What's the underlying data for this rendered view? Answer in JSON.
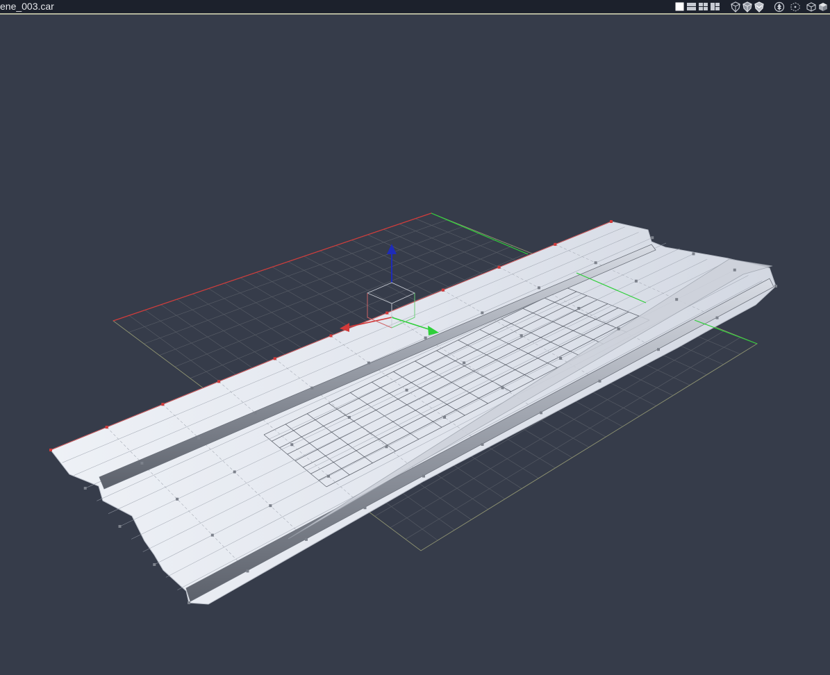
{
  "window": {
    "title": "ene_003.car"
  },
  "toolbar": {
    "layout_buttons": [
      {
        "icon": "single-view-icon",
        "active": true
      },
      {
        "icon": "two-row-view-icon",
        "active": false
      },
      {
        "icon": "four-view-icon",
        "active": false
      },
      {
        "icon": "three-view-icon",
        "active": false
      }
    ],
    "shading_buttons": [
      {
        "icon": "wireframe-shield-icon"
      },
      {
        "icon": "flat-shield-icon"
      },
      {
        "icon": "smooth-shield-icon"
      }
    ],
    "view_buttons": [
      {
        "icon": "tree-icon"
      },
      {
        "icon": "selection-cube-icon"
      },
      {
        "icon": "wire-cube-icon"
      },
      {
        "icon": "solid-cube-icon"
      }
    ]
  },
  "scene": {
    "background_color": "#363c4a",
    "grid_color": "#555a64",
    "axis_x_color": "#d23a3a",
    "axis_y_color": "#2fcf3a",
    "axis_z_color": "#1e2bb8",
    "mesh_color": "#e6e9f0"
  }
}
